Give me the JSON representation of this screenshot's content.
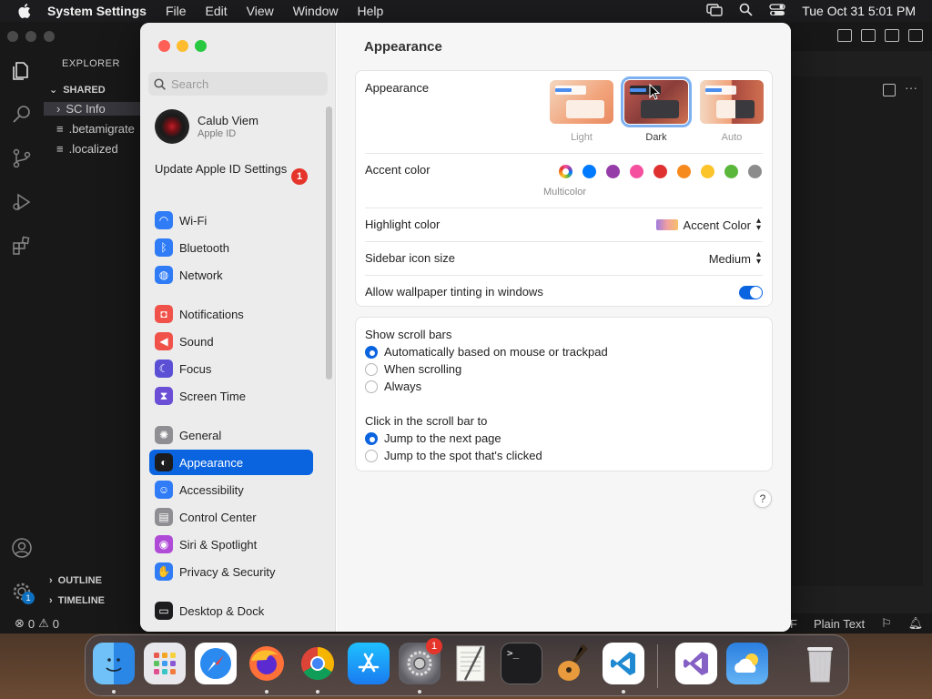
{
  "menubar": {
    "app_name": "System Settings",
    "items": [
      "File",
      "Edit",
      "View",
      "Window",
      "Help"
    ],
    "clock": "Tue Oct 31  5:01 PM"
  },
  "vscode": {
    "explorer_title": "EXPLORER",
    "folder": "SHARED",
    "files": [
      "SC Info",
      ".betamigrate",
      ".localized"
    ],
    "sections": [
      "OUTLINE",
      "TIMELINE"
    ],
    "status_errors": "0",
    "status_warnings": "0",
    "status_lang_suffix": "F",
    "status_lang": "Plain Text",
    "settings_badge": "1"
  },
  "settings": {
    "search_placeholder": "Search",
    "account": {
      "name": "Calub Viem",
      "sub": "Apple ID"
    },
    "update_label": "Update Apple ID Settings",
    "update_badge": "1",
    "sidebar": [
      {
        "label": "Wi-Fi",
        "icon": "wifi-icon",
        "color": "#2f7cf6"
      },
      {
        "label": "Bluetooth",
        "icon": "bluetooth-icon",
        "color": "#2f7cf6"
      },
      {
        "label": "Network",
        "icon": "globe-icon",
        "color": "#2f7cf6"
      },
      {
        "label": "Notifications",
        "icon": "bell-icon",
        "color": "#f0524a"
      },
      {
        "label": "Sound",
        "icon": "speaker-icon",
        "color": "#f0524a"
      },
      {
        "label": "Focus",
        "icon": "moon-icon",
        "color": "#5b4fd6"
      },
      {
        "label": "Screen Time",
        "icon": "hourglass-icon",
        "color": "#6a4fd6"
      },
      {
        "label": "General",
        "icon": "gear-icon",
        "color": "#8e8e93"
      },
      {
        "label": "Appearance",
        "icon": "appearance-icon",
        "color": "#1c1c1e"
      },
      {
        "label": "Accessibility",
        "icon": "accessibility-icon",
        "color": "#2f7cf6"
      },
      {
        "label": "Control Center",
        "icon": "control-center-icon",
        "color": "#8e8e93"
      },
      {
        "label": "Siri & Spotlight",
        "icon": "siri-icon",
        "color": "#b04bd8"
      },
      {
        "label": "Privacy & Security",
        "icon": "hand-icon",
        "color": "#2f7cf6"
      },
      {
        "label": "Desktop & Dock",
        "icon": "dock-icon",
        "color": "#1c1c1e"
      }
    ],
    "content": {
      "title": "Appearance",
      "appearance_label": "Appearance",
      "modes": [
        "Light",
        "Dark",
        "Auto"
      ],
      "selected_mode": "Dark",
      "accent_label": "Accent color",
      "accent_colors": [
        "#007aff",
        "#953ca8",
        "#f54f9f",
        "#e03131",
        "#f78a1c",
        "#fcc42b",
        "#5bb73b",
        "#8c8c8c"
      ],
      "multicolor_label": "Multicolor",
      "highlight_label": "Highlight color",
      "highlight_value": "Accent Color",
      "icon_size_label": "Sidebar icon size",
      "icon_size_value": "Medium",
      "tinting_label": "Allow wallpaper tinting in windows",
      "tinting_on": true,
      "scroll_label": "Show scroll bars",
      "scroll_options": [
        "Automatically based on mouse or trackpad",
        "When scrolling",
        "Always"
      ],
      "click_label": "Click in the scroll bar to",
      "click_options": [
        "Jump to the next page",
        "Jump to the spot that's clicked"
      ],
      "help": "?"
    }
  },
  "dock": {
    "apps": [
      "Finder",
      "Launchpad",
      "Safari",
      "Firefox",
      "Chrome",
      "App Store",
      "System Settings",
      "TextEdit",
      "Terminal",
      "GarageBand",
      "Visual Studio Code",
      "Visual Studio",
      "Weather",
      "Trash"
    ],
    "settings_badge": "1"
  }
}
